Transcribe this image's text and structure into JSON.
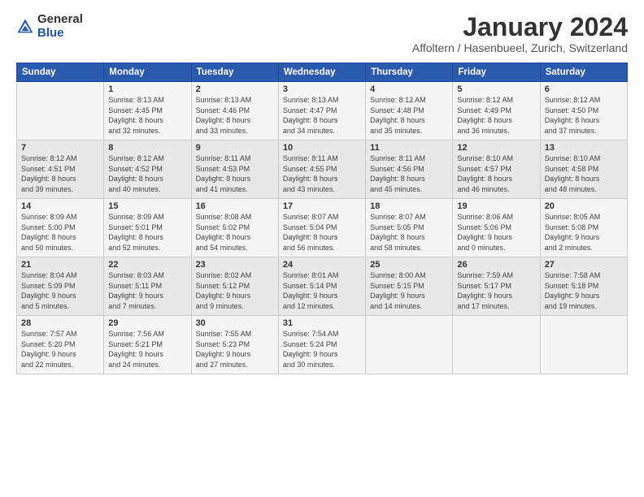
{
  "logo": {
    "general": "General",
    "blue": "Blue"
  },
  "title": "January 2024",
  "location": "Affoltern / Hasenbueel, Zurich, Switzerland",
  "days_of_week": [
    "Sunday",
    "Monday",
    "Tuesday",
    "Wednesday",
    "Thursday",
    "Friday",
    "Saturday"
  ],
  "weeks": [
    [
      {
        "day": "",
        "info": ""
      },
      {
        "day": "1",
        "info": "Sunrise: 8:13 AM\nSunset: 4:45 PM\nDaylight: 8 hours\nand 32 minutes."
      },
      {
        "day": "2",
        "info": "Sunrise: 8:13 AM\nSunset: 4:46 PM\nDaylight: 8 hours\nand 33 minutes."
      },
      {
        "day": "3",
        "info": "Sunrise: 8:13 AM\nSunset: 4:47 PM\nDaylight: 8 hours\nand 34 minutes."
      },
      {
        "day": "4",
        "info": "Sunrise: 8:12 AM\nSunset: 4:48 PM\nDaylight: 8 hours\nand 35 minutes."
      },
      {
        "day": "5",
        "info": "Sunrise: 8:12 AM\nSunset: 4:49 PM\nDaylight: 8 hours\nand 36 minutes."
      },
      {
        "day": "6",
        "info": "Sunrise: 8:12 AM\nSunset: 4:50 PM\nDaylight: 8 hours\nand 37 minutes."
      }
    ],
    [
      {
        "day": "7",
        "info": "Sunrise: 8:12 AM\nSunset: 4:51 PM\nDaylight: 8 hours\nand 39 minutes."
      },
      {
        "day": "8",
        "info": "Sunrise: 8:12 AM\nSunset: 4:52 PM\nDaylight: 8 hours\nand 40 minutes."
      },
      {
        "day": "9",
        "info": "Sunrise: 8:11 AM\nSunset: 4:53 PM\nDaylight: 8 hours\nand 41 minutes."
      },
      {
        "day": "10",
        "info": "Sunrise: 8:11 AM\nSunset: 4:55 PM\nDaylight: 8 hours\nand 43 minutes."
      },
      {
        "day": "11",
        "info": "Sunrise: 8:11 AM\nSunset: 4:56 PM\nDaylight: 8 hours\nand 45 minutes."
      },
      {
        "day": "12",
        "info": "Sunrise: 8:10 AM\nSunset: 4:57 PM\nDaylight: 8 hours\nand 46 minutes."
      },
      {
        "day": "13",
        "info": "Sunrise: 8:10 AM\nSunset: 4:58 PM\nDaylight: 8 hours\nand 48 minutes."
      }
    ],
    [
      {
        "day": "14",
        "info": "Sunrise: 8:09 AM\nSunset: 5:00 PM\nDaylight: 8 hours\nand 50 minutes."
      },
      {
        "day": "15",
        "info": "Sunrise: 8:09 AM\nSunset: 5:01 PM\nDaylight: 8 hours\nand 52 minutes."
      },
      {
        "day": "16",
        "info": "Sunrise: 8:08 AM\nSunset: 5:02 PM\nDaylight: 8 hours\nand 54 minutes."
      },
      {
        "day": "17",
        "info": "Sunrise: 8:07 AM\nSunset: 5:04 PM\nDaylight: 8 hours\nand 56 minutes."
      },
      {
        "day": "18",
        "info": "Sunrise: 8:07 AM\nSunset: 5:05 PM\nDaylight: 8 hours\nand 58 minutes."
      },
      {
        "day": "19",
        "info": "Sunrise: 8:06 AM\nSunset: 5:06 PM\nDaylight: 9 hours\nand 0 minutes."
      },
      {
        "day": "20",
        "info": "Sunrise: 8:05 AM\nSunset: 5:08 PM\nDaylight: 9 hours\nand 2 minutes."
      }
    ],
    [
      {
        "day": "21",
        "info": "Sunrise: 8:04 AM\nSunset: 5:09 PM\nDaylight: 9 hours\nand 5 minutes."
      },
      {
        "day": "22",
        "info": "Sunrise: 8:03 AM\nSunset: 5:11 PM\nDaylight: 9 hours\nand 7 minutes."
      },
      {
        "day": "23",
        "info": "Sunrise: 8:02 AM\nSunset: 5:12 PM\nDaylight: 9 hours\nand 9 minutes."
      },
      {
        "day": "24",
        "info": "Sunrise: 8:01 AM\nSunset: 5:14 PM\nDaylight: 9 hours\nand 12 minutes."
      },
      {
        "day": "25",
        "info": "Sunrise: 8:00 AM\nSunset: 5:15 PM\nDaylight: 9 hours\nand 14 minutes."
      },
      {
        "day": "26",
        "info": "Sunrise: 7:59 AM\nSunset: 5:17 PM\nDaylight: 9 hours\nand 17 minutes."
      },
      {
        "day": "27",
        "info": "Sunrise: 7:58 AM\nSunset: 5:18 PM\nDaylight: 9 hours\nand 19 minutes."
      }
    ],
    [
      {
        "day": "28",
        "info": "Sunrise: 7:57 AM\nSunset: 5:20 PM\nDaylight: 9 hours\nand 22 minutes."
      },
      {
        "day": "29",
        "info": "Sunrise: 7:56 AM\nSunset: 5:21 PM\nDaylight: 9 hours\nand 24 minutes."
      },
      {
        "day": "30",
        "info": "Sunrise: 7:55 AM\nSunset: 5:23 PM\nDaylight: 9 hours\nand 27 minutes."
      },
      {
        "day": "31",
        "info": "Sunrise: 7:54 AM\nSunset: 5:24 PM\nDaylight: 9 hours\nand 30 minutes."
      },
      {
        "day": "",
        "info": ""
      },
      {
        "day": "",
        "info": ""
      },
      {
        "day": "",
        "info": ""
      }
    ]
  ]
}
